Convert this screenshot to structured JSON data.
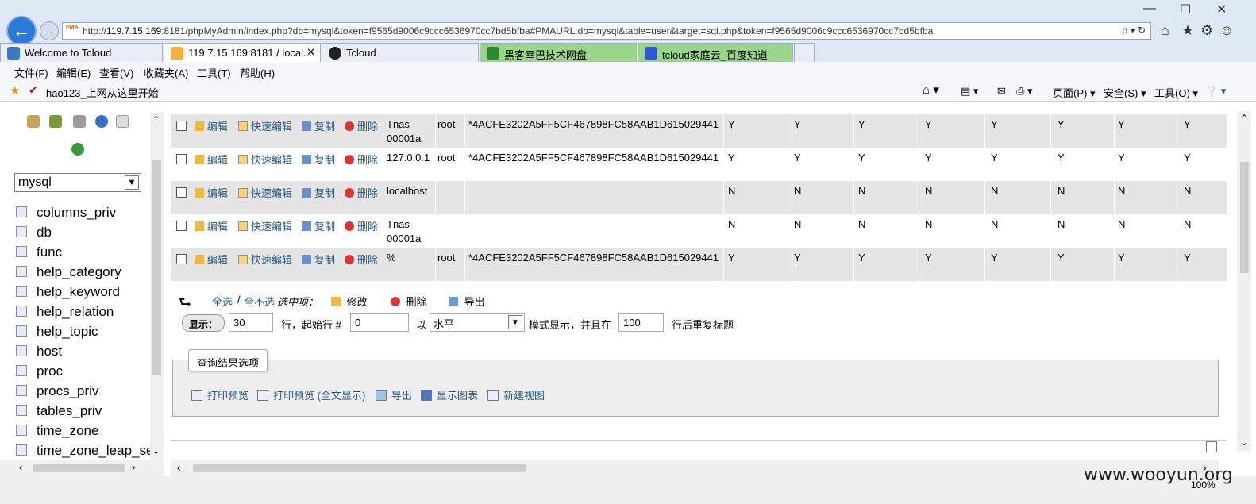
{
  "browser": {
    "address_url_prefix": "http://",
    "address_url_host": "119.7.15.169",
    "address_url_rest": ":8181/phpMyAdmin/index.php?db=mysql&token=f9565d9006c9ccc6536970cc7bd5bfba#PMAURL:db=mysql&table=user&target=sql.php&token=f9565d9006c9ccc6536970cc7bd5bfba",
    "address_controls": "ρ ▾ ↻",
    "tabs": [
      {
        "label": "Welcome to Tcloud"
      },
      {
        "label": "119.7.15.169:8181 / local..."
      },
      {
        "label": "Tcloud"
      },
      {
        "label": "黑客幸巴技术网盘"
      },
      {
        "label": "tcloud家庭云_百度知道"
      }
    ],
    "menu": [
      "文件(F)",
      "编辑(E)",
      "查看(V)",
      "收藏夹(A)",
      "工具(T)",
      "帮助(H)"
    ],
    "favorites": {
      "hao123": "hao123_上网从这里开始"
    },
    "toolbar": {
      "page": "页面(P)",
      "safety": "安全(S)",
      "tools": "工具(O)"
    },
    "zoom": "100%"
  },
  "sidebar": {
    "db_selected": "mysql",
    "tables": [
      "columns_priv",
      "db",
      "func",
      "help_category",
      "help_keyword",
      "help_relation",
      "help_topic",
      "host",
      "proc",
      "procs_priv",
      "tables_priv",
      "time_zone",
      "time_zone_leap_se"
    ]
  },
  "grid": {
    "actions": {
      "edit": "编辑",
      "quick_edit": "快速编辑",
      "copy": "复制",
      "delete": "删除"
    },
    "rows": [
      {
        "host1": "Tnas-",
        "host2": "00001a",
        "user": "root",
        "password": "*4ACFE3202A5FF5CF467898FC58AAB1D615029441",
        "privs": [
          "Y",
          "Y",
          "Y",
          "Y",
          "Y",
          "Y",
          "Y",
          "Y"
        ]
      },
      {
        "host1": "127.0.0.1",
        "host2": "",
        "user": "root",
        "password": "*4ACFE3202A5FF5CF467898FC58AAB1D615029441",
        "privs": [
          "Y",
          "Y",
          "Y",
          "Y",
          "Y",
          "Y",
          "Y",
          "Y"
        ]
      },
      {
        "host1": "localhost",
        "host2": "",
        "user": "",
        "password": "",
        "privs": [
          "N",
          "N",
          "N",
          "N",
          "N",
          "N",
          "N",
          "N"
        ]
      },
      {
        "host1": "Tnas-",
        "host2": "00001a",
        "user": "",
        "password": "",
        "privs": [
          "N",
          "N",
          "N",
          "N",
          "N",
          "N",
          "N",
          "N"
        ]
      },
      {
        "host1": "%",
        "host2": "",
        "user": "root",
        "password": "*4ACFE3202A5FF5CF467898FC58AAB1D615029441",
        "privs": [
          "Y",
          "Y",
          "Y",
          "Y",
          "Y",
          "Y",
          "Y",
          "Y"
        ]
      }
    ]
  },
  "bulk": {
    "check_all": "全选",
    "separator": "/",
    "uncheck_all": "全不选",
    "with_selected": "选中项：",
    "change": "修改",
    "delete": "删除",
    "export": "导出"
  },
  "display": {
    "button": "显示：",
    "rows_value": "30",
    "rows_label": "行，起始行 #",
    "start_value": "0",
    "mode_prefix": "以",
    "mode_value": "水平",
    "mode_suffix": "模式显示，并且在",
    "repeat_value": "100",
    "repeat_suffix": "行后重复标题"
  },
  "query_options": {
    "legend": "查询结果选项",
    "print_preview": "打印预览",
    "print_preview_full": "打印预览 (全文显示)",
    "export": "导出",
    "show_chart": "显示图表",
    "new_view": "新建视图"
  },
  "watermark": "www.wooyun.org"
}
